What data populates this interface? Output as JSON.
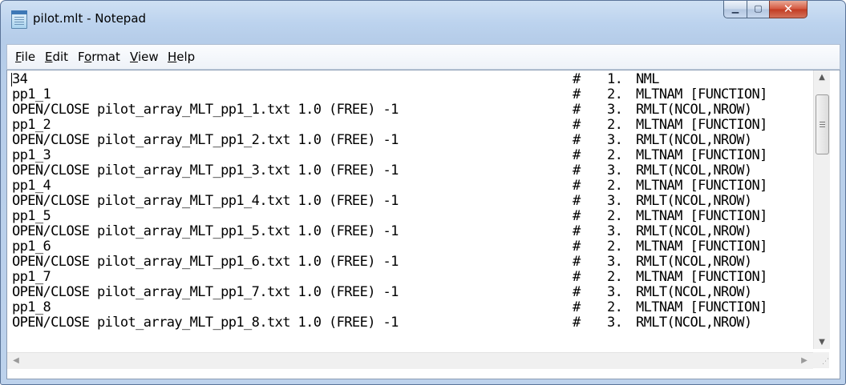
{
  "window": {
    "title": "pilot.mlt - Notepad",
    "icon": "notepad-icon",
    "controls": {
      "minimize": "▁",
      "maximize": "▢",
      "close": "✕"
    }
  },
  "menu": [
    {
      "label": "File",
      "accel": "F",
      "rest": "ile"
    },
    {
      "label": "Edit",
      "accel": "E",
      "rest": "dit"
    },
    {
      "label": "Format",
      "accel": "o",
      "pre": "F",
      "rest": "rmat"
    },
    {
      "label": "View",
      "accel": "V",
      "rest": "iew"
    },
    {
      "label": "Help",
      "accel": "H",
      "rest": "elp"
    }
  ],
  "lines": [
    {
      "main": "34",
      "hash": "#",
      "num": "1.",
      "comment": "NML"
    },
    {
      "main": "pp1_1",
      "hash": "#",
      "num": "2.",
      "comment": "MLTNAM [FUNCTION]"
    },
    {
      "main": "OPEN/CLOSE pilot_array_MLT_pp1_1.txt 1.0 (FREE) -1",
      "hash": "#",
      "num": "3.",
      "comment": "RMLT(NCOL,NROW)"
    },
    {
      "main": "pp1_2",
      "hash": "#",
      "num": "2.",
      "comment": "MLTNAM [FUNCTION]"
    },
    {
      "main": "OPEN/CLOSE pilot_array_MLT_pp1_2.txt 1.0 (FREE) -1",
      "hash": "#",
      "num": "3.",
      "comment": "RMLT(NCOL,NROW)"
    },
    {
      "main": "pp1_3",
      "hash": "#",
      "num": "2.",
      "comment": "MLTNAM [FUNCTION]"
    },
    {
      "main": "OPEN/CLOSE pilot_array_MLT_pp1_3.txt 1.0 (FREE) -1",
      "hash": "#",
      "num": "3.",
      "comment": "RMLT(NCOL,NROW)"
    },
    {
      "main": "pp1_4",
      "hash": "#",
      "num": "2.",
      "comment": "MLTNAM [FUNCTION]"
    },
    {
      "main": "OPEN/CLOSE pilot_array_MLT_pp1_4.txt 1.0 (FREE) -1",
      "hash": "#",
      "num": "3.",
      "comment": "RMLT(NCOL,NROW)"
    },
    {
      "main": "pp1_5",
      "hash": "#",
      "num": "2.",
      "comment": "MLTNAM [FUNCTION]"
    },
    {
      "main": "OPEN/CLOSE pilot_array_MLT_pp1_5.txt 1.0 (FREE) -1",
      "hash": "#",
      "num": "3.",
      "comment": "RMLT(NCOL,NROW)"
    },
    {
      "main": "pp1_6",
      "hash": "#",
      "num": "2.",
      "comment": "MLTNAM [FUNCTION]"
    },
    {
      "main": "OPEN/CLOSE pilot_array_MLT_pp1_6.txt 1.0 (FREE) -1",
      "hash": "#",
      "num": "3.",
      "comment": "RMLT(NCOL,NROW)"
    },
    {
      "main": "pp1_7",
      "hash": "#",
      "num": "2.",
      "comment": "MLTNAM [FUNCTION]"
    },
    {
      "main": "OPEN/CLOSE pilot_array_MLT_pp1_7.txt 1.0 (FREE) -1",
      "hash": "#",
      "num": "3.",
      "comment": "RMLT(NCOL,NROW)"
    },
    {
      "main": "pp1_8",
      "hash": "#",
      "num": "2.",
      "comment": "MLTNAM [FUNCTION]"
    },
    {
      "main": "OPEN/CLOSE pilot_array_MLT_pp1_8.txt 1.0 (FREE) -1",
      "hash": "#",
      "num": "3.",
      "comment": "RMLT(NCOL,NROW)"
    }
  ],
  "scrollbars": {
    "vertical": {
      "up": "▲",
      "down": "▼",
      "grip": "scrollbar-grip-icon"
    },
    "horizontal": {
      "left": "◀",
      "right": "▶"
    },
    "sizegrip": "⋰"
  }
}
